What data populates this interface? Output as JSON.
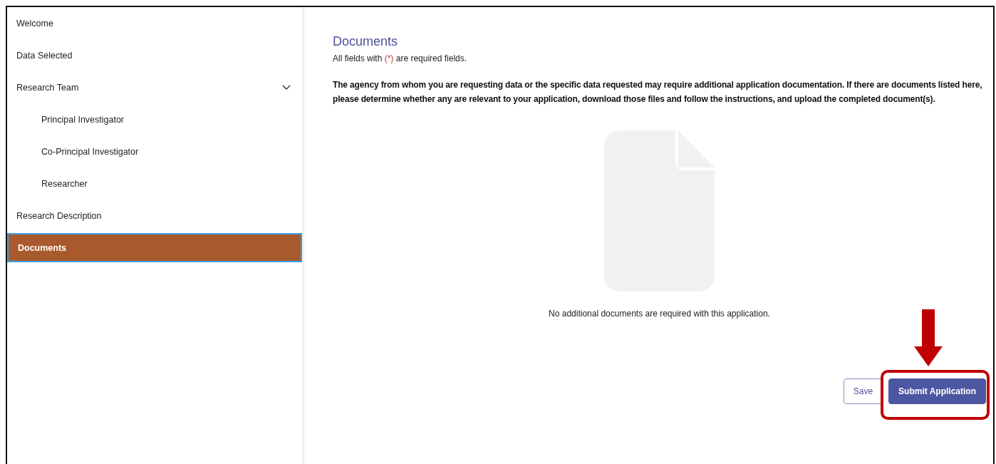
{
  "sidebar": {
    "items": [
      {
        "label": "Welcome",
        "selected": false
      },
      {
        "label": "Data Selected",
        "selected": false
      },
      {
        "label": "Research Team",
        "selected": false,
        "expanded": true,
        "children": [
          {
            "label": "Principal Investigator",
            "selected": false
          },
          {
            "label": "Co-Principal Investigator",
            "selected": false
          },
          {
            "label": "Researcher",
            "selected": false
          }
        ]
      },
      {
        "label": "Research Description",
        "selected": false
      },
      {
        "label": "Documents",
        "selected": true
      }
    ]
  },
  "main": {
    "title": "Documents",
    "required_note": {
      "before": "All fields with ",
      "mark": "(*)",
      "after": " are required fields."
    },
    "instructions": "The agency from whom you are requesting data or the specific data requested may require additional application documentation. If there are documents listed here, please determine whether any are relevant to your application, download those files and follow the instructions, and upload the completed document(s).",
    "empty_message": "No additional documents are required with this application.",
    "buttons": [
      {
        "label": "Save",
        "kind": "secondary",
        "highlighted": false
      },
      {
        "label": "Submit Application",
        "kind": "primary",
        "highlighted": true
      }
    ]
  }
}
